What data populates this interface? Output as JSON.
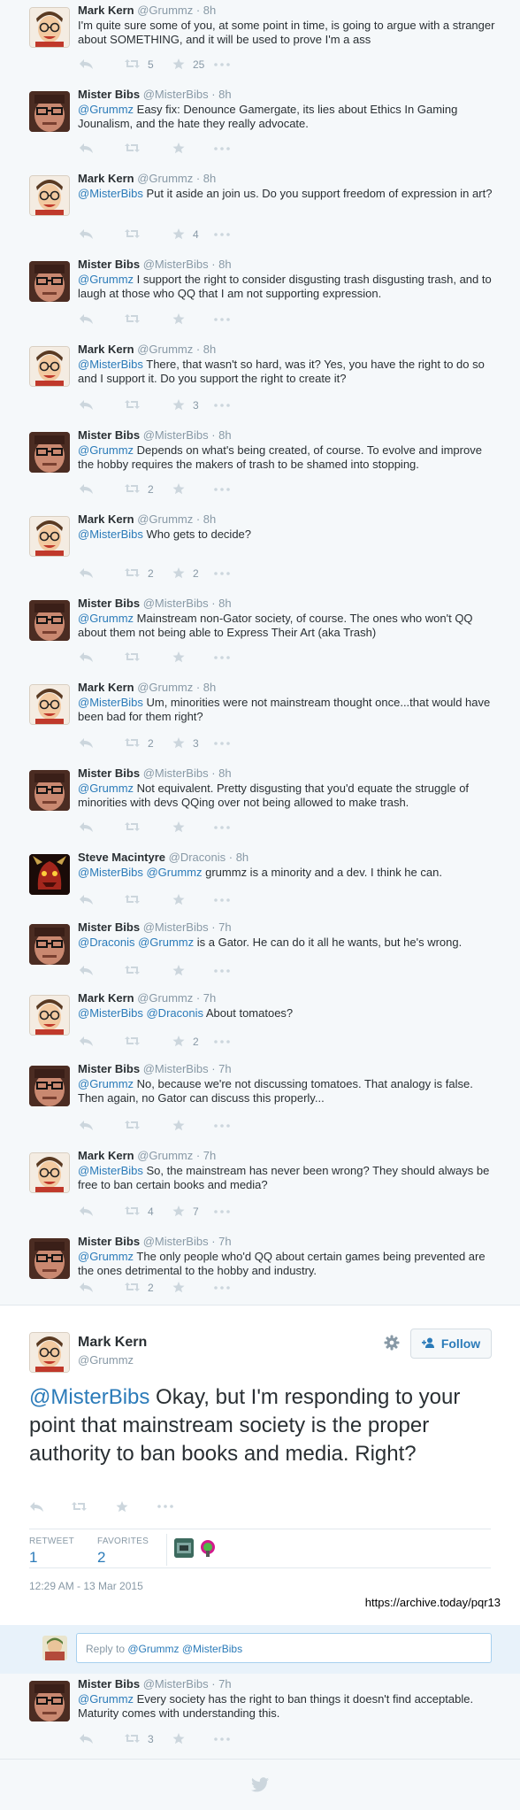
{
  "tweets": [
    {
      "name": "Mark Kern",
      "handle": "@Grummz",
      "time": "8h",
      "mentions": "",
      "text": "I'm quite sure some of you, at some point in time, is going to argue with a stranger about SOMETHING, and it will be used to prove I'm a ass",
      "retweets": "5",
      "favorites": "25"
    },
    {
      "name": "Mister Bibs",
      "handle": "@MisterBibs",
      "time": "8h",
      "mentions": "@Grummz",
      "text": " Easy fix: Denounce Gamergate, its lies about Ethics In Gaming Jounalism, and the hate they really advocate.",
      "retweets": "",
      "favorites": ""
    },
    {
      "name": "Mark Kern",
      "handle": "@Grummz",
      "time": "8h",
      "mentions": "@MisterBibs",
      "text": " Put it aside an join us. Do you support freedom of expression in art?",
      "retweets": "",
      "favorites": "4"
    },
    {
      "name": "Mister Bibs",
      "handle": "@MisterBibs",
      "time": "8h",
      "mentions": "@Grummz",
      "text": " I support the right to consider disgusting trash disgusting trash, and to laugh at those who QQ that I am not supporting expression.",
      "retweets": "",
      "favorites": ""
    },
    {
      "name": "Mark Kern",
      "handle": "@Grummz",
      "time": "8h",
      "mentions": "@MisterBibs",
      "text": " There, that wasn't so hard, was it? Yes, you have the right to do so and I support it. Do you support the right to create it?",
      "retweets": "",
      "favorites": "3"
    },
    {
      "name": "Mister Bibs",
      "handle": "@MisterBibs",
      "time": "8h",
      "mentions": "@Grummz",
      "text": " Depends on what's being created, of course. To evolve and improve the hobby requires the makers of trash to be shamed into stopping.",
      "retweets": "2",
      "favorites": ""
    },
    {
      "name": "Mark Kern",
      "handle": "@Grummz",
      "time": "8h",
      "mentions": "@MisterBibs",
      "text": " Who gets to decide?",
      "retweets": "2",
      "favorites": "2"
    },
    {
      "name": "Mister Bibs",
      "handle": "@MisterBibs",
      "time": "8h",
      "mentions": "@Grummz",
      "text": " Mainstream non-Gator society, of course. The ones who won't QQ about them not being able to Express Their Art (aka Trash)",
      "retweets": "",
      "favorites": ""
    },
    {
      "name": "Mark Kern",
      "handle": "@Grummz",
      "time": "8h",
      "mentions": "@MisterBibs",
      "text": " Um, minorities were not mainstream thought once...that would have been bad for them right?",
      "retweets": "2",
      "favorites": "3"
    },
    {
      "name": "Mister Bibs",
      "handle": "@MisterBibs",
      "time": "8h",
      "mentions": "@Grummz",
      "text": " Not equivalent. Pretty disgusting that you'd equate the struggle of minorities with devs QQing over not being allowed to make trash.",
      "retweets": "",
      "favorites": ""
    },
    {
      "name": "Steve Macintyre",
      "handle": "@Draconis",
      "time": "8h",
      "mentions": "@MisterBibs @Grummz",
      "text": " grummz is a minority and a dev. I think he can.",
      "retweets": "",
      "favorites": ""
    },
    {
      "name": "Mister Bibs",
      "handle": "@MisterBibs",
      "time": "7h",
      "mentions": "@Draconis @Grummz",
      "text": " is a Gator. He can do it all he wants, but he's wrong.",
      "retweets": "",
      "favorites": ""
    },
    {
      "name": "Mark Kern",
      "handle": "@Grummz",
      "time": "7h",
      "mentions": "@MisterBibs @Draconis",
      "text": " About tomatoes?",
      "retweets": "",
      "favorites": "2"
    },
    {
      "name": "Mister Bibs",
      "handle": "@MisterBibs",
      "time": "7h",
      "mentions": "@Grummz",
      "text": " No, because we're not discussing tomatoes. That analogy is false. Then again, no Gator can discuss this properly...",
      "retweets": "",
      "favorites": ""
    },
    {
      "name": "Mark Kern",
      "handle": "@Grummz",
      "time": "7h",
      "mentions": "@MisterBibs",
      "text": " So, the mainstream has never been wrong? They should always be free to ban certain books and media?",
      "retweets": "4",
      "favorites": "7"
    },
    {
      "name": "Mister Bibs",
      "handle": "@MisterBibs",
      "time": "7h",
      "mentions": "@Grummz",
      "text": " The only people who'd QQ about certain games being prevented are the ones detrimental to the hobby and industry.",
      "retweets": "2",
      "favorites": ""
    }
  ],
  "main": {
    "name": "Mark Kern",
    "handle": "@Grummz",
    "follow_label": "Follow",
    "mention": "@MisterBibs",
    "text": " Okay, but I'm responding to your point that mainstream society is the proper authority to ban books and media. Right?",
    "retweet_label": "RETWEET",
    "retweet_count": "1",
    "favorites_label": "FAVORITES",
    "favorites_count": "2",
    "timestamp": "12:29 AM - 13 Mar 2015",
    "archive_url": "https://archive.today/pqr13"
  },
  "reply_box": {
    "prefix": "Reply to ",
    "mentions": "@Grummz @MisterBibs"
  },
  "reply": {
    "name": "Mister Bibs",
    "handle": "@MisterBibs",
    "time": "7h",
    "mentions": "@Grummz",
    "text": " Every society has the right to ban things it doesn't find acceptable. Maturity comes with understanding this.",
    "retweets": "3",
    "favorites": ""
  },
  "icons": {
    "reply": "reply-icon",
    "retweet": "retweet-icon",
    "favorite": "star-icon",
    "more": "more-icon",
    "settings": "gear-icon",
    "follow": "follow-user-icon",
    "footer": "twitter-bird-icon"
  },
  "colors": {
    "link": "#2b7bb9",
    "action": "#8899a6",
    "background": "#f5f8fa"
  }
}
